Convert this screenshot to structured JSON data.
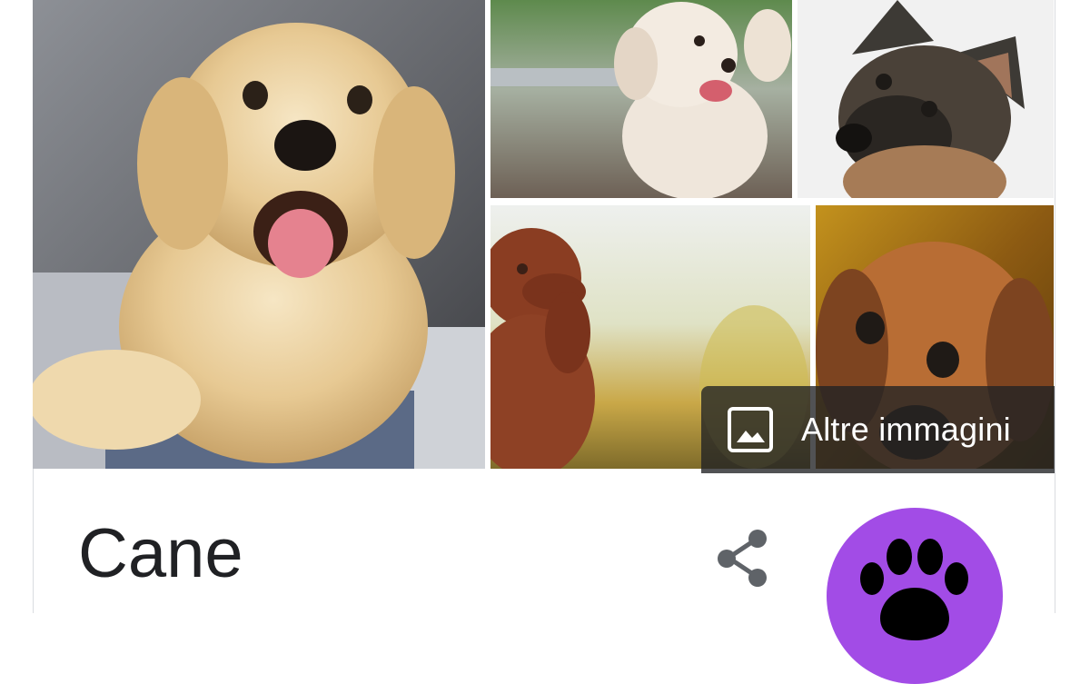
{
  "knowledge_panel": {
    "images": [
      {
        "icon": "golden-retriever-puppy-photo"
      },
      {
        "icon": "poodle-photo"
      },
      {
        "icon": "german-shepherd-photo"
      },
      {
        "icon": "vizsla-photo"
      },
      {
        "icon": "brown-dog-photo"
      }
    ],
    "more_images_label": "Altre immagini",
    "title": "Cane",
    "share_icon": "share-icon",
    "logo_icon": "paw-icon",
    "colors": {
      "logo_bg": "#a24ce6",
      "overlay": "#202124",
      "title_text": "#202124"
    }
  }
}
